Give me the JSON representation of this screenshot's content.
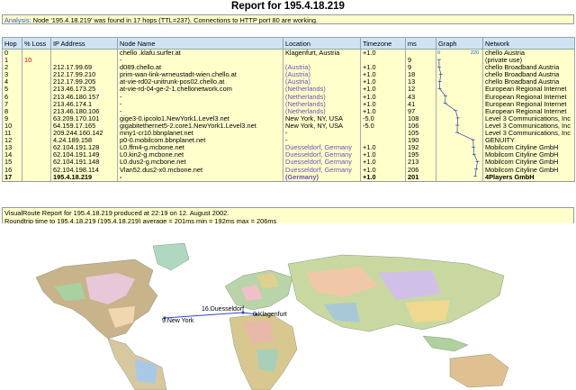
{
  "title": "Report for 195.4.18.219",
  "analysis": {
    "label": "Analysis:",
    "text": "Node '195.4.18.219' was found in 17 hops (TTL=237). Connections to HTTP port 80 are working."
  },
  "table": {
    "headers": [
      "Hop",
      "% Loss",
      "IP Address",
      "Node Name",
      "Location",
      "Timezone",
      "ms",
      "Graph",
      "Network"
    ],
    "graph_scale_min": "0",
    "graph_scale_max": "220",
    "rows": [
      {
        "hop": "0",
        "loss": "",
        "ip": "",
        "node": "chello                    .klafu.surfer.at",
        "loc": "Klagenfurt, Austria",
        "loc_fade": false,
        "tz": "+1.0",
        "ms": "",
        "net": "chello Austria"
      },
      {
        "hop": "1",
        "loss": "10",
        "ip": "",
        "node": "-",
        "loc": "",
        "loc_fade": false,
        "tz": "",
        "ms": "9",
        "net": "(private use)"
      },
      {
        "hop": "2",
        "loss": "",
        "ip": "212.17.99.69",
        "node": "d089.chello.at",
        "loc": "(Austria)",
        "loc_fade": true,
        "tz": "+1.0",
        "ms": "9",
        "net": "chello Broadband Austria"
      },
      {
        "hop": "3",
        "loss": "",
        "ip": "212.17.99.210",
        "node": "prim-wan-link-wrneustadt-wien.chello.at",
        "loc": "(Austria)",
        "loc_fade": true,
        "tz": "+1.0",
        "ms": "18",
        "net": "chello Broadband Austria"
      },
      {
        "hop": "4",
        "loss": "",
        "ip": "212.17.99.205",
        "node": "at-vie-rd02-unitrunk-pos02.chello.at",
        "loc": "(Austria)",
        "loc_fade": true,
        "tz": "+1.0",
        "ms": "13",
        "net": "chello Broadband Austria"
      },
      {
        "hop": "5",
        "loss": "",
        "ip": "213.46.173.25",
        "node": "at-vie-rd-04-ge-2-1.chellonetwork.com",
        "loc": "(Netherlands)",
        "loc_fade": true,
        "tz": "+1.0",
        "ms": "12",
        "net": "European Regional Internet"
      },
      {
        "hop": "6",
        "loss": "",
        "ip": "213.46.180.157",
        "node": "-",
        "loc": "(Netherlands)",
        "loc_fade": true,
        "tz": "+1.0",
        "ms": "43",
        "net": "European Regional Internet"
      },
      {
        "hop": "7",
        "loss": "",
        "ip": "213.46.174.1",
        "node": "-",
        "loc": "(Netherlands)",
        "loc_fade": true,
        "tz": "+1.0",
        "ms": "41",
        "net": "European Regional Internet"
      },
      {
        "hop": "8",
        "loss": "",
        "ip": "213.46.180.106",
        "node": "-",
        "loc": "(Netherlands)",
        "loc_fade": true,
        "tz": "+1.0",
        "ms": "97",
        "net": "European Regional Internet"
      },
      {
        "hop": "9",
        "loss": "",
        "ip": "63.209.170.101",
        "node": "gige3-0.ipcolo1.NewYork1.Level3.net",
        "loc": "New York, NY, USA",
        "loc_fade": false,
        "tz": "-5.0",
        "ms": "108",
        "net": "Level 3 Communications, Inc"
      },
      {
        "hop": "10",
        "loss": "",
        "ip": "64.159.17.165",
        "node": "gigabitethernet5-2.core1.NewYork1.Level3.net",
        "loc": "New York, NY, USA",
        "loc_fade": false,
        "tz": "-5.0",
        "ms": "106",
        "net": "Level 3 Communications, Inc"
      },
      {
        "hop": "11",
        "loss": "",
        "ip": "209.244.160.142",
        "node": "mny1-cr10.bbnplanet.net",
        "loc": "-",
        "loc_fade": false,
        "tz": "",
        "ms": "105",
        "net": "Level 3 Communications, Inc"
      },
      {
        "hop": "12",
        "loss": "",
        "ip": "4.24.189.158",
        "node": "p0-0.mobilcom.bbnplanet.net",
        "loc": "-",
        "loc_fade": false,
        "tz": "",
        "ms": "190",
        "net": "GENUITY"
      },
      {
        "hop": "13",
        "loss": "",
        "ip": "62.104.191.128",
        "node": "L0.ffm4-g.mcbone.net",
        "loc": "Duesseldorf, Germany",
        "loc_fade": true,
        "tz": "+1.0",
        "ms": "192",
        "net": "Mobilcom Cityline GmbH"
      },
      {
        "hop": "14",
        "loss": "",
        "ip": "62.104.191.149",
        "node": "L0.kin2-g.mcbone.net",
        "loc": "Duesseldorf, Germany",
        "loc_fade": true,
        "tz": "+1.0",
        "ms": "195",
        "net": "Mobilcom Cityline GmbH"
      },
      {
        "hop": "15",
        "loss": "",
        "ip": "62.104.191.148",
        "node": "L0.dus2-g.mcbone.net",
        "loc": "Duesseldorf, Germany",
        "loc_fade": true,
        "tz": "+1.0",
        "ms": "213",
        "net": "Mobilcom Cityline GmbH"
      },
      {
        "hop": "16",
        "loss": "",
        "ip": "62.104.198.114",
        "node": "Vlan52.dus2-x0.mcbone.net",
        "loc": "Duesseldorf, Germany",
        "loc_fade": true,
        "tz": "+1.0",
        "ms": "206",
        "net": "Mobilcom Cityline GmbH"
      },
      {
        "hop": "17",
        "loss": "",
        "ip": "195.4.18.219",
        "node": "-",
        "loc": "(Germany)",
        "loc_fade": true,
        "tz": "+1.0",
        "ms": "201",
        "net": "4Players GmbH"
      }
    ]
  },
  "footer": {
    "line1": "VisualRoute Report for 195.4.18.219 produced at 22:19 on 12. August 2002.",
    "line2": "Roundtrip time to 195.4.18.219 (195.4.18.219) average = 201ms min = 192ms max = 206ms"
  },
  "map": {
    "label_newyork": "9.New York",
    "label_duesseldorf": "16.Duesseldorf",
    "label_klagenfurt": "0.Klagenfurt",
    "route_color": "#3344cc",
    "ocean_color": "#ffffff"
  }
}
